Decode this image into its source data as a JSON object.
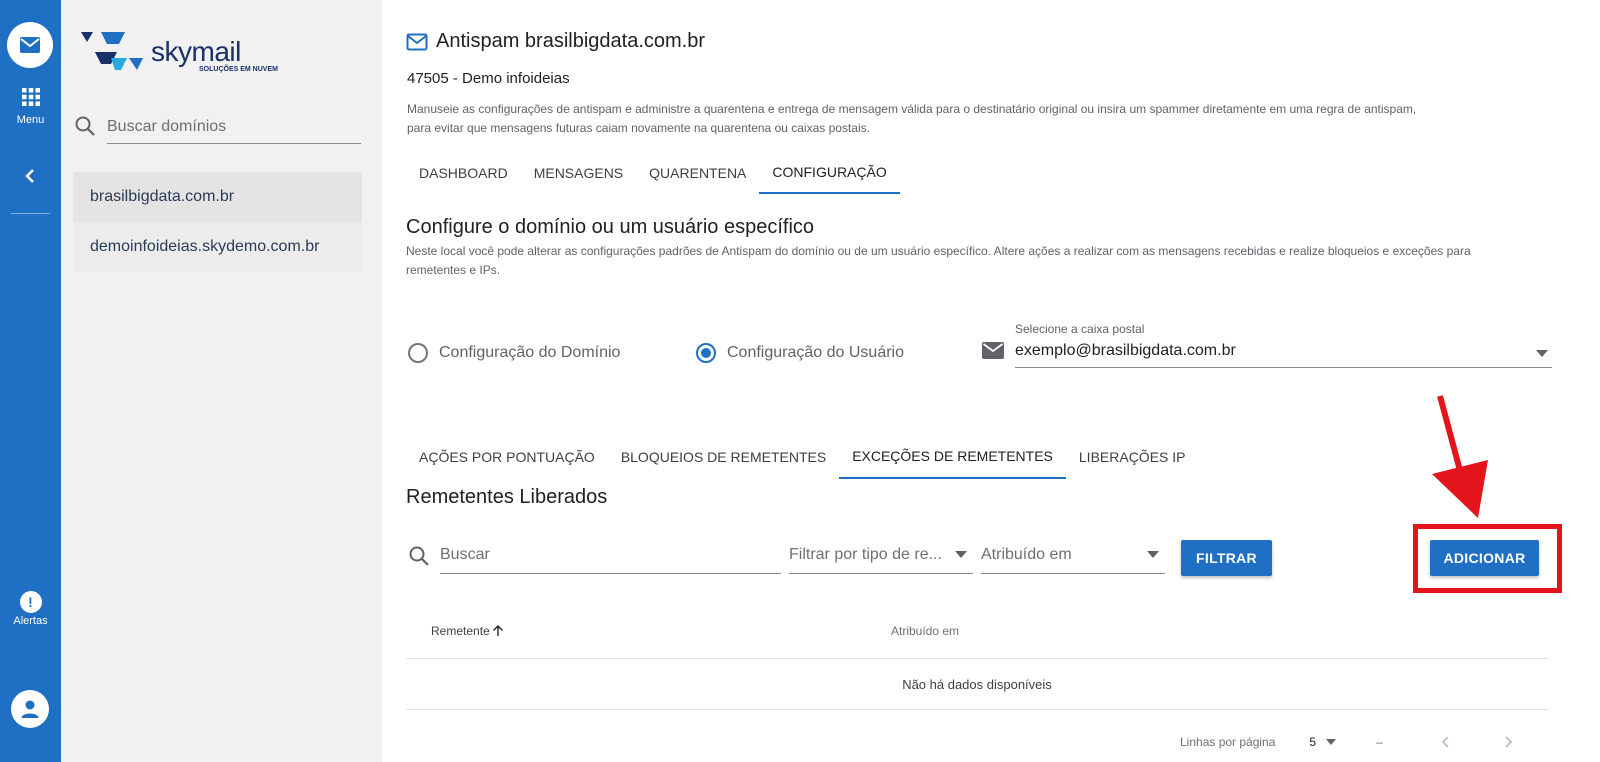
{
  "rail": {
    "menu_label": "Menu",
    "alerts_label": "Alertas",
    "alerts_badge": "!",
    "accent": "#1f6fc4"
  },
  "panel": {
    "logo_name": "skymail",
    "logo_tagline": "SOLUÇÕES EM NUVEM",
    "search_placeholder": "Buscar domínios",
    "domains": [
      {
        "label": "brasilbigdata.com.br"
      },
      {
        "label": "demoinfoideias.skydemo.com.br"
      }
    ]
  },
  "header": {
    "title": "Antispam brasilbigdata.com.br",
    "account": "47505 - Demo infoideias",
    "description_line1": "Manuseie as configurações de antispam e administre a quarentena e entrega de mensagem válida para o destinatário original ou insira um spammer diretamente em uma regra de antispam,",
    "description_line2": "para evitar que mensagens futuras caiam novamente na quarentena ou caixas postais."
  },
  "main_tabs": [
    {
      "label": "DASHBOARD"
    },
    {
      "label": "MENSAGENS"
    },
    {
      "label": "QUARENTENA"
    },
    {
      "label": "CONFIGURAÇÃO"
    }
  ],
  "config": {
    "title": "Configure o domínio ou um usuário específico",
    "description_line1": "Neste local você pode alterar as configurações padrões de Antispam do domínio ou de um usuário específico. Altere ações a realizar com as mensagens recebidas e realize bloqueios e exceções para",
    "description_line2": "remetentes e IPs.",
    "radio_domain": "Configuração do Domínio",
    "radio_user": "Configuração do Usuário",
    "mailbox_label": "Selecione a caixa postal",
    "mailbox_value": "exemplo@brasilbigdata.com.br"
  },
  "sub_tabs": [
    {
      "label": "AÇÕES POR PONTUAÇÃO"
    },
    {
      "label": "BLOQUEIOS DE REMETENTES"
    },
    {
      "label": "EXCEÇÕES DE REMETENTES"
    },
    {
      "label": "LIBERAÇÕES IP"
    }
  ],
  "list": {
    "title": "Remetentes Liberados",
    "search_placeholder": "Buscar",
    "filter_type_placeholder": "Filtrar por tipo de re...",
    "assigned_placeholder": "Atribuído em",
    "filter_button": "FILTRAR",
    "add_button": "ADICIONAR",
    "col_sender": "Remetente",
    "col_assigned": "Atribuído em",
    "empty_text": "Não há dados disponíveis",
    "rows_per_page_label": "Linhas por página",
    "rows_per_page_value": "5",
    "range_text": "–"
  },
  "annotation_color": "#e3141b"
}
